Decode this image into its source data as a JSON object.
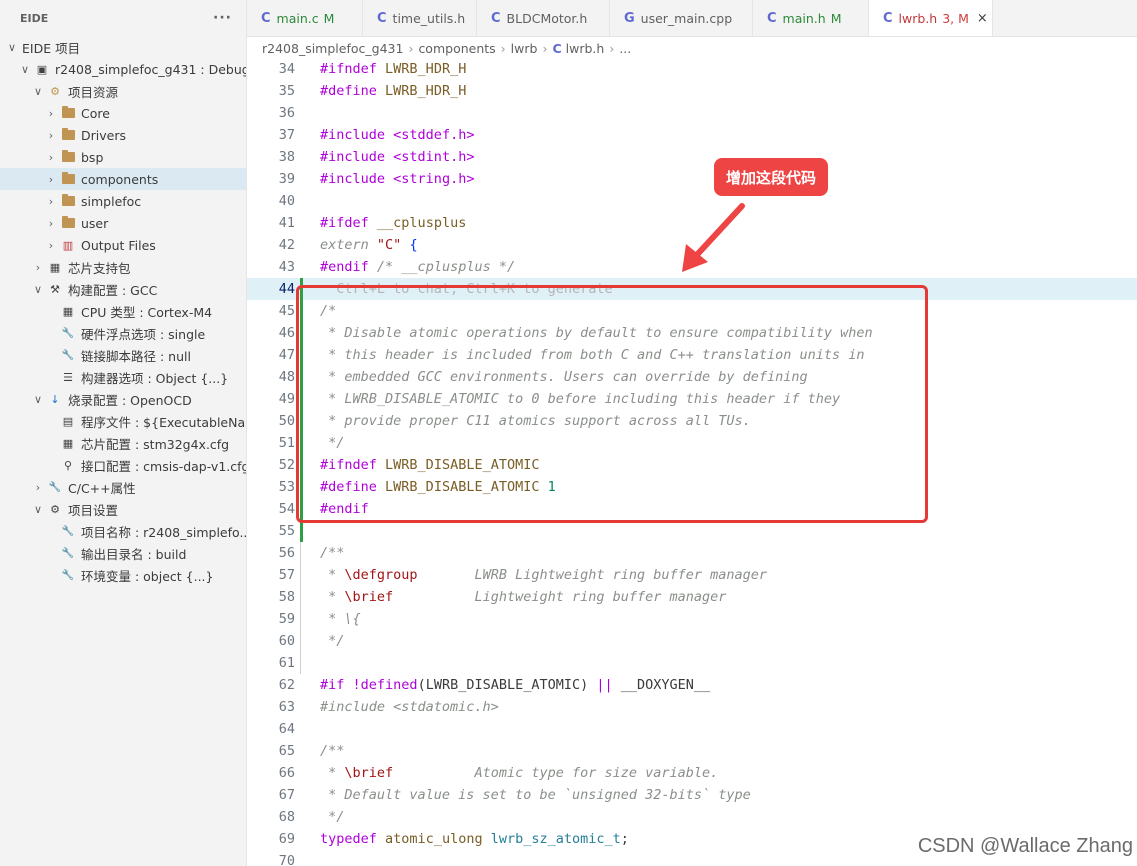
{
  "sidebar": {
    "title": "EIDE",
    "more": "···",
    "items": [
      {
        "label": "EIDE 项目",
        "twisty": "∨",
        "icon": "none-icon"
      },
      {
        "label": "r2408_simplefoc_g431 : Debug",
        "twisty": "∨",
        "icon": "project-icon"
      },
      {
        "label": "项目资源",
        "twisty": "∨",
        "icon": "resources-icon"
      },
      {
        "label": "Core",
        "twisty": "›",
        "icon": "folder-icon"
      },
      {
        "label": "Drivers",
        "twisty": "›",
        "icon": "folder-icon"
      },
      {
        "label": "bsp",
        "twisty": "›",
        "icon": "folder-icon"
      },
      {
        "label": "components",
        "twisty": "›",
        "icon": "folder-icon"
      },
      {
        "label": "simplefoc",
        "twisty": "›",
        "icon": "folder-icon"
      },
      {
        "label": "user",
        "twisty": "›",
        "icon": "folder-icon"
      },
      {
        "label": "Output Files",
        "twisty": "›",
        "icon": "output-icon"
      },
      {
        "label": "芯片支持包",
        "twisty": "›",
        "icon": "chip-icon"
      },
      {
        "label": "构建配置 : GCC",
        "twisty": "∨",
        "icon": "hammer-icon"
      },
      {
        "label": "CPU 类型 : Cortex-M4",
        "twisty": "",
        "icon": "chip-icon"
      },
      {
        "label": "硬件浮点选项 : single",
        "twisty": "",
        "icon": "wrench-icon"
      },
      {
        "label": "链接脚本路径 : null",
        "twisty": "",
        "icon": "wrench-icon"
      },
      {
        "label": "构建器选项 : Object {...}",
        "twisty": "",
        "icon": "options-icon"
      },
      {
        "label": "烧录配置 : OpenOCD",
        "twisty": "∨",
        "icon": "download-icon"
      },
      {
        "label": "程序文件 : ${ExecutableNa...",
        "twisty": "",
        "icon": "binary-icon"
      },
      {
        "label": "芯片配置 : stm32g4x.cfg",
        "twisty": "",
        "icon": "chip-icon"
      },
      {
        "label": "接口配置 : cmsis-dap-v1.cfg",
        "twisty": "",
        "icon": "plug-icon"
      },
      {
        "label": "C/C++属性",
        "twisty": "›",
        "icon": "wrench-icon"
      },
      {
        "label": "项目设置",
        "twisty": "∨",
        "icon": "gear-icon"
      },
      {
        "label": "项目名称 : r2408_simplefo...",
        "twisty": "",
        "icon": "wrench-icon"
      },
      {
        "label": "输出目录名 : build",
        "twisty": "",
        "icon": "wrench-icon"
      },
      {
        "label": "环境变量 : object {...}",
        "twisty": "",
        "icon": "wrench-icon"
      }
    ]
  },
  "tabs": [
    {
      "label": "main.c",
      "badge": "M",
      "lang": "C"
    },
    {
      "label": "time_utils.h",
      "badge": "",
      "lang": "C"
    },
    {
      "label": "BLDCMotor.h",
      "badge": "",
      "lang": "C"
    },
    {
      "label": "user_main.cpp",
      "badge": "",
      "lang": "C++"
    },
    {
      "label": "main.h",
      "badge": "M",
      "lang": "C"
    },
    {
      "label": "lwrb.h",
      "badge": "3, M",
      "lang": "C",
      "close": "×"
    }
  ],
  "breadcrumb": {
    "parts": [
      "r2408_simplefoc_g431",
      "components",
      "lwrb"
    ],
    "file_lang": "C",
    "file": "lwrb.h",
    "tail": "..."
  },
  "editor": {
    "current_line": "44",
    "lines": [
      {
        "n": "34",
        "segs": [
          [
            "pp",
            "#ifndef"
          ],
          [
            "t",
            " "
          ],
          [
            "mac",
            "LWRB_HDR_H"
          ]
        ]
      },
      {
        "n": "35",
        "segs": [
          [
            "pp",
            "#define"
          ],
          [
            "t",
            " "
          ],
          [
            "mac",
            "LWRB_HDR_H"
          ]
        ]
      },
      {
        "n": "36",
        "segs": []
      },
      {
        "n": "37",
        "segs": [
          [
            "pp",
            "#include"
          ],
          [
            "t",
            " "
          ],
          [
            "tag",
            "<stddef.h>"
          ]
        ]
      },
      {
        "n": "38",
        "segs": [
          [
            "pp",
            "#include"
          ],
          [
            "t",
            " "
          ],
          [
            "tag",
            "<stdint.h>"
          ]
        ]
      },
      {
        "n": "39",
        "segs": [
          [
            "pp",
            "#include"
          ],
          [
            "t",
            " "
          ],
          [
            "tag",
            "<string.h>"
          ]
        ]
      },
      {
        "n": "40",
        "segs": []
      },
      {
        "n": "41",
        "segs": [
          [
            "pp",
            "#ifdef"
          ],
          [
            "t",
            " "
          ],
          [
            "mac",
            "__cplusplus"
          ]
        ]
      },
      {
        "n": "42",
        "segs": [
          [
            "cm",
            "extern"
          ],
          [
            "t",
            " "
          ],
          [
            "str",
            "\"C\""
          ],
          [
            "t",
            " "
          ],
          [
            "br",
            "{"
          ]
        ]
      },
      {
        "n": "43",
        "segs": [
          [
            "pp",
            "#endif"
          ],
          [
            "t",
            " "
          ],
          [
            "cm",
            "/* __cplusplus */"
          ]
        ]
      },
      {
        "n": "44",
        "segs": [
          [
            "ghost",
            "  Ctrl+L to chat, Ctrl+K to generate"
          ]
        ]
      },
      {
        "n": "45",
        "segs": [
          [
            "cm",
            "/*"
          ]
        ]
      },
      {
        "n": "46",
        "segs": [
          [
            "cm",
            " * Disable atomic operations by default to ensure compatibility when"
          ]
        ]
      },
      {
        "n": "47",
        "segs": [
          [
            "cm",
            " * this header is included from both C and C++ translation units in"
          ]
        ]
      },
      {
        "n": "48",
        "segs": [
          [
            "cm",
            " * embedded GCC environments. Users can override by defining"
          ]
        ]
      },
      {
        "n": "49",
        "segs": [
          [
            "cm",
            " * LWRB_DISABLE_ATOMIC to 0 before including this header if they"
          ]
        ]
      },
      {
        "n": "50",
        "segs": [
          [
            "cm",
            " * provide proper C11 atomics support across all TUs."
          ]
        ]
      },
      {
        "n": "51",
        "segs": [
          [
            "cm",
            " */"
          ]
        ]
      },
      {
        "n": "52",
        "segs": [
          [
            "pp",
            "#ifndef"
          ],
          [
            "t",
            " "
          ],
          [
            "mac",
            "LWRB_DISABLE_ATOMIC"
          ]
        ]
      },
      {
        "n": "53",
        "segs": [
          [
            "pp",
            "#define"
          ],
          [
            "t",
            " "
          ],
          [
            "mac",
            "LWRB_DISABLE_ATOMIC"
          ],
          [
            "t",
            " "
          ],
          [
            "num",
            "1"
          ]
        ]
      },
      {
        "n": "54",
        "segs": [
          [
            "pp",
            "#endif"
          ]
        ]
      },
      {
        "n": "55",
        "segs": []
      },
      {
        "n": "56",
        "segs": [
          [
            "cm",
            "/**"
          ]
        ]
      },
      {
        "n": "57",
        "segs": [
          [
            "cm",
            " * "
          ],
          [
            "str",
            "\\defgroup"
          ],
          [
            "cm",
            "       LWRB Lightweight ring buffer manager"
          ]
        ]
      },
      {
        "n": "58",
        "segs": [
          [
            "cm",
            " * "
          ],
          [
            "str",
            "\\brief"
          ],
          [
            "cm",
            "          Lightweight ring buffer manager"
          ]
        ]
      },
      {
        "n": "59",
        "segs": [
          [
            "cm",
            " * \\{"
          ]
        ]
      },
      {
        "n": "60",
        "segs": [
          [
            "cm",
            " */"
          ]
        ]
      },
      {
        "n": "61",
        "segs": []
      },
      {
        "n": "62",
        "segs": [
          [
            "pp",
            "#if"
          ],
          [
            "t",
            " "
          ],
          [
            "k",
            "!defined"
          ],
          [
            "t",
            "(LWRB_DISABLE_ATOMIC) "
          ],
          [
            "k",
            "||"
          ],
          [
            "t",
            " __DOXYGEN__"
          ]
        ]
      },
      {
        "n": "63",
        "segs": [
          [
            "cm",
            "#include <stdatomic.h>"
          ]
        ]
      },
      {
        "n": "64",
        "segs": []
      },
      {
        "n": "65",
        "segs": [
          [
            "cm",
            "/**"
          ]
        ]
      },
      {
        "n": "66",
        "segs": [
          [
            "cm",
            " * "
          ],
          [
            "str",
            "\\brief"
          ],
          [
            "cm",
            "          Atomic type for size variable."
          ]
        ]
      },
      {
        "n": "67",
        "segs": [
          [
            "cm",
            " * Default value is set to be `unsigned 32-bits` type"
          ]
        ]
      },
      {
        "n": "68",
        "segs": [
          [
            "cm",
            " */"
          ]
        ]
      },
      {
        "n": "69",
        "segs": [
          [
            "k",
            "typedef"
          ],
          [
            "t",
            " "
          ],
          [
            "mac",
            "atomic_ulong"
          ],
          [
            "t",
            " "
          ],
          [
            "type",
            "lwrb_sz_atomic_t"
          ],
          [
            "t",
            ";"
          ]
        ]
      },
      {
        "n": "70",
        "segs": []
      }
    ]
  },
  "annotation": {
    "callout_text": "增加这段代码"
  },
  "watermark": "CSDN @Wallace Zhang",
  "colors": {
    "accent": "#ef4444",
    "keyword": "#af00db",
    "macro": "#795e26",
    "comment": "#8a8f8a",
    "string": "#a31515"
  }
}
